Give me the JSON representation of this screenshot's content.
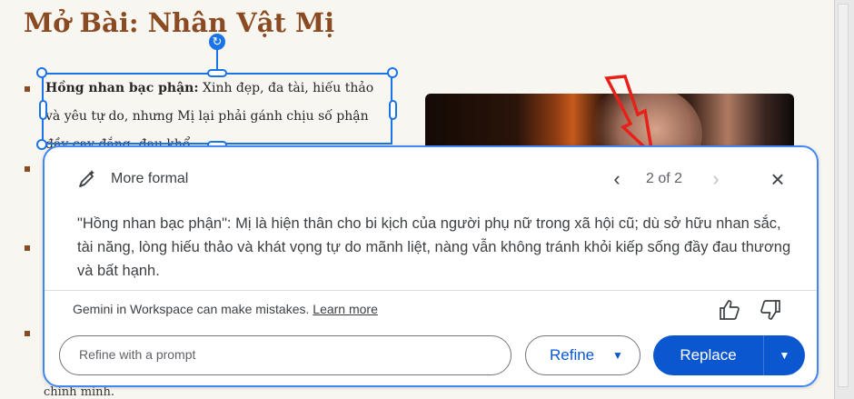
{
  "slide": {
    "title": "Mở Bài: Nhân Vật Mị",
    "bullet1_bold": "Hồng nhan bạc phận:",
    "bullet1_rest": " Xinh đẹp, đa tài, hiếu thảo và yêu tự do, nhưng Mị lại phải gánh chịu số phận đầy cay đắng, đau khổ.",
    "bottom_text": "chính mình."
  },
  "panel": {
    "mode_icon": "pen-sparkle-icon",
    "mode_label": "More formal",
    "prev_icon": "chevron-left-icon",
    "counter": "2 of 2",
    "next_icon": "chevron-right-icon",
    "close_icon": "close-icon",
    "suggestion_text": "\"Hồng nhan bạc phận\": Mị là hiện thân cho bi kịch của người phụ nữ trong xã hội cũ; dù sở hữu nhan sắc, tài năng, lòng hiếu thảo và khát vọng tự do mãnh liệt, nàng vẫn không tránh khỏi kiếp sống đầy đau thương và bất hạnh.",
    "disclaimer": "Gemini in Workspace can make mistakes.",
    "learn_more": "Learn more",
    "prompt_placeholder": "Refine with a prompt",
    "refine_label": "Refine",
    "replace_label": "Replace"
  },
  "colors": {
    "title": "#8b4b22",
    "accent_blue": "#0b57d0",
    "selection_blue": "#1a73e8",
    "annotation_red": "#e8201a"
  }
}
